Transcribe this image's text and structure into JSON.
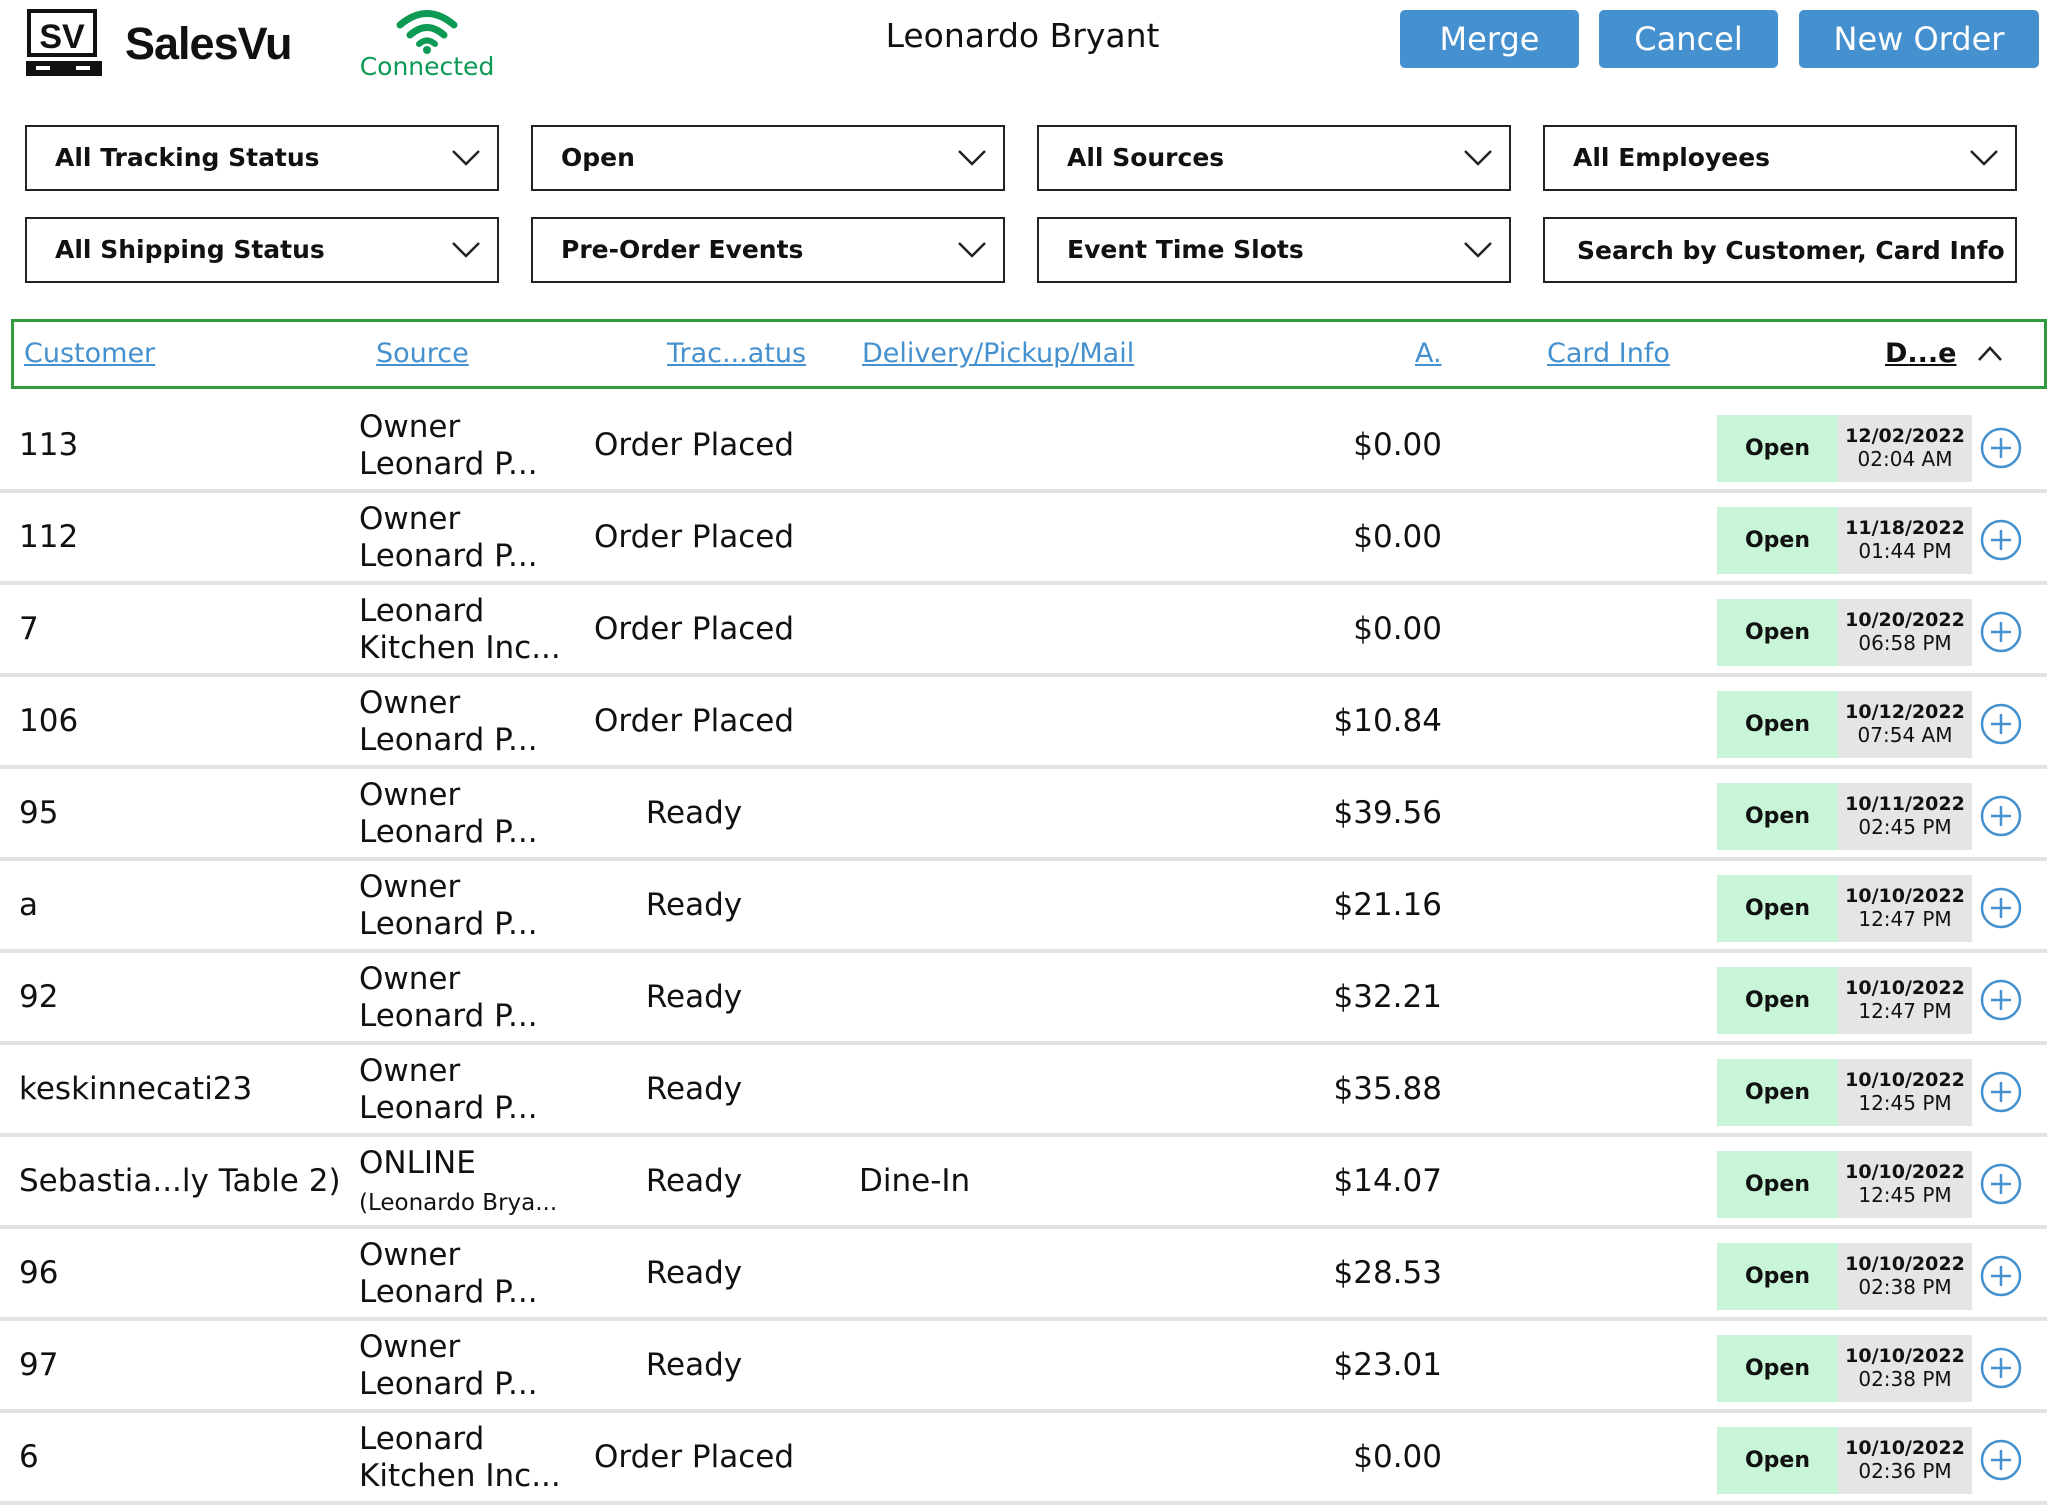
{
  "header": {
    "brand": "SalesVu",
    "logo_text": "SV",
    "connection_status": "Connected",
    "user_name": "Leonardo Bryant",
    "buttons": {
      "merge": "Merge",
      "cancel": "Cancel",
      "new_order": "New Order"
    }
  },
  "filters": {
    "tracking_status": "All Tracking Status",
    "order_status": "Open",
    "sources": "All Sources",
    "employees": "All Employees",
    "shipping_status": "All Shipping Status",
    "pre_order_events": "Pre-Order Events",
    "event_time_slots": "Event Time Slots",
    "search_placeholder": "Search by Customer, Card Info"
  },
  "columns": {
    "customer": "Customer",
    "source": "Source",
    "tracking": "Trac...atus",
    "delivery": "Delivery/Pickup/Mail",
    "amount": "A.",
    "card_info": "Card Info",
    "date": "D...e"
  },
  "rows": [
    {
      "customer": "113",
      "source_l1": "Owner",
      "source_l2": "Leonard P...",
      "tracking": "Order Placed",
      "delivery": "",
      "amount": "$0.00",
      "status": "Open",
      "date": "12/02/2022",
      "time": "02:04 AM"
    },
    {
      "customer": "112",
      "source_l1": "Owner",
      "source_l2": "Leonard P...",
      "tracking": "Order Placed",
      "delivery": "",
      "amount": "$0.00",
      "status": "Open",
      "date": "11/18/2022",
      "time": "01:44 PM"
    },
    {
      "customer": "7",
      "source_l1": "Leonard",
      "source_l2": "Kitchen Inc...",
      "tracking": "Order Placed",
      "delivery": "",
      "amount": "$0.00",
      "status": "Open",
      "date": "10/20/2022",
      "time": "06:58 PM"
    },
    {
      "customer": "106",
      "source_l1": "Owner",
      "source_l2": "Leonard P...",
      "tracking": "Order Placed",
      "delivery": "",
      "amount": "$10.84",
      "status": "Open",
      "date": "10/12/2022",
      "time": "07:54 AM"
    },
    {
      "customer": "95",
      "source_l1": "Owner",
      "source_l2": "Leonard P...",
      "tracking": "Ready",
      "delivery": "",
      "amount": "$39.56",
      "status": "Open",
      "date": "10/11/2022",
      "time": "02:45 PM"
    },
    {
      "customer": "a",
      "source_l1": "Owner",
      "source_l2": "Leonard P...",
      "tracking": "Ready",
      "delivery": "",
      "amount": "$21.16",
      "status": "Open",
      "date": "10/10/2022",
      "time": "12:47 PM"
    },
    {
      "customer": "92",
      "source_l1": "Owner",
      "source_l2": "Leonard P...",
      "tracking": "Ready",
      "delivery": "",
      "amount": "$32.21",
      "status": "Open",
      "date": "10/10/2022",
      "time": "12:47 PM"
    },
    {
      "customer": "keskinnecati23",
      "source_l1": "Owner",
      "source_l2": "Leonard P...",
      "tracking": "Ready",
      "delivery": "",
      "amount": "$35.88",
      "status": "Open",
      "date": "10/10/2022",
      "time": "12:45 PM"
    },
    {
      "customer": "Sebastia...ly Table 2)",
      "source_l1": "ONLINE",
      "source_l2": "(Leonardo  Brya...",
      "source_small": true,
      "tracking": "Ready",
      "delivery": "Dine-In",
      "amount": "$14.07",
      "status": "Open",
      "date": "10/10/2022",
      "time": "12:45 PM"
    },
    {
      "customer": "96",
      "source_l1": "Owner",
      "source_l2": "Leonard P...",
      "tracking": "Ready",
      "delivery": "",
      "amount": "$28.53",
      "status": "Open",
      "date": "10/10/2022",
      "time": "02:38 PM"
    },
    {
      "customer": "97",
      "source_l1": "Owner",
      "source_l2": "Leonard P...",
      "tracking": "Ready",
      "delivery": "",
      "amount": "$23.01",
      "status": "Open",
      "date": "10/10/2022",
      "time": "02:38 PM"
    },
    {
      "customer": "6",
      "source_l1": "Leonard",
      "source_l2": "Kitchen Inc...",
      "tracking": "Order Placed",
      "delivery": "",
      "amount": "$0.00",
      "status": "Open",
      "date": "10/10/2022",
      "time": "02:36 PM"
    }
  ],
  "colors": {
    "accent": "#4591cf",
    "connected": "#0c9a55",
    "selection_border": "#2e9a3b",
    "status_pill": "#c8f5d7",
    "date_box": "#e5e5e5"
  },
  "icons": {
    "logo": "salesvu-logo-icon",
    "wifi": "wifi-icon",
    "dropdown": "chevron-down-icon",
    "sort": "chevron-up-icon",
    "add": "plus-circle-icon"
  }
}
